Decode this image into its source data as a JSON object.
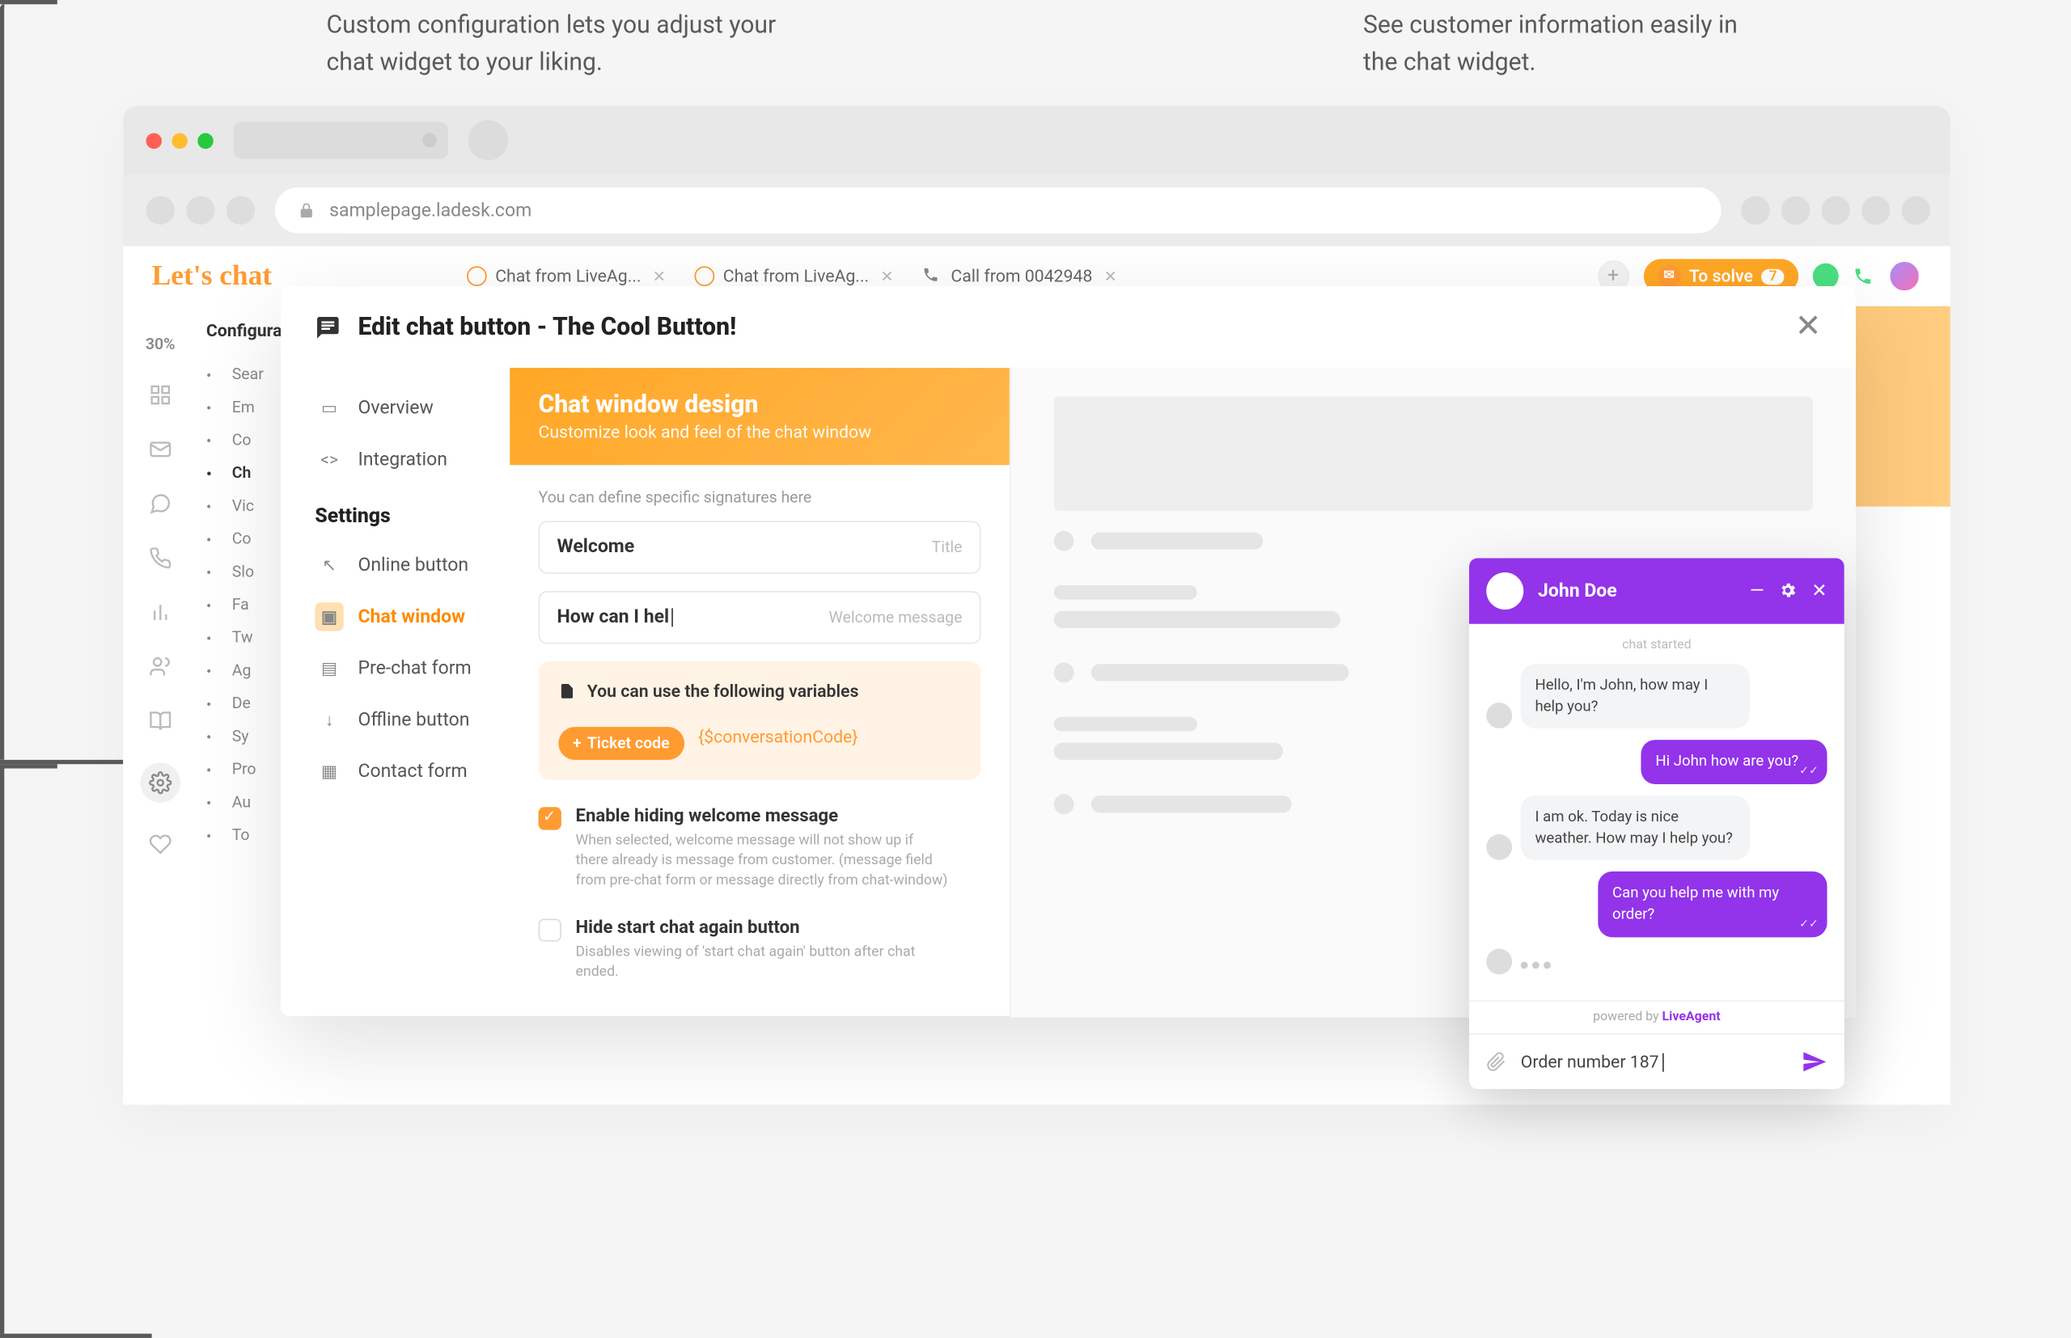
{
  "annotations": {
    "left": "Custom configuration lets you adjust your chat widget to your liking.",
    "right": "See customer information easily in the chat widget."
  },
  "browser": {
    "url": "samplepage.ladesk.com"
  },
  "app": {
    "logo": "Let's chat",
    "tabs": [
      {
        "label": "Chat from LiveAg...",
        "type": "chat"
      },
      {
        "label": "Chat from LiveAg...",
        "type": "chat"
      },
      {
        "label": "Call from 0042948",
        "type": "call"
      }
    ],
    "to_solve": {
      "label": "To solve",
      "count": "7"
    },
    "rail_pct": "30%"
  },
  "config_panel": {
    "title": "Configuration",
    "items": [
      "Sear",
      "Em",
      "Co",
      "Ch",
      "Vic",
      "Co",
      "Slo",
      "Fa",
      "Tw",
      "Ag",
      "De",
      "Sy",
      "Pro",
      "Au",
      "To"
    ],
    "active_index": 3
  },
  "modal": {
    "title": "Edit chat button - The Cool Button!",
    "nav": {
      "top": [
        "Overview",
        "Integration"
      ],
      "settings_heading": "Settings",
      "settings": [
        "Online button",
        "Chat window",
        "Pre-chat form",
        "Offline button",
        "Contact form"
      ],
      "active": "Chat window"
    },
    "design": {
      "title": "Chat window design",
      "subtitle": "Customize look and feel of the chat window",
      "hint": "You can define specific signatures here",
      "field_title": {
        "value": "Welcome",
        "label": "Title"
      },
      "field_welcome": {
        "value": "How can I hel",
        "label": "Welcome message"
      },
      "vars_title": "You can use the following variables",
      "ticket_chip": "Ticket code",
      "var_code": "{$conversationCode}",
      "opt1": {
        "label": "Enable hiding welcome message",
        "desc": "When selected, welcome message will not show up if there already is message from customer. (message field from pre-chat form or message directly from chat-window)"
      },
      "opt2": {
        "label": "Hide start chat again button",
        "desc": "Disables viewing of 'start chat again' button after chat ended."
      }
    }
  },
  "chat": {
    "agent": "John Doe",
    "started": "chat started",
    "messages": [
      {
        "side": "agent",
        "text": "Hello, I'm John, how may I help you?"
      },
      {
        "side": "user",
        "text": "Hi John how are you?"
      },
      {
        "side": "agent",
        "text": "I am ok. Today is nice weather. How may I help you?"
      },
      {
        "side": "user",
        "text": "Can you help me with my order?"
      }
    ],
    "powered_pre": "powered by ",
    "powered_brand": "LiveAgent",
    "input_value": "Order number 187"
  }
}
